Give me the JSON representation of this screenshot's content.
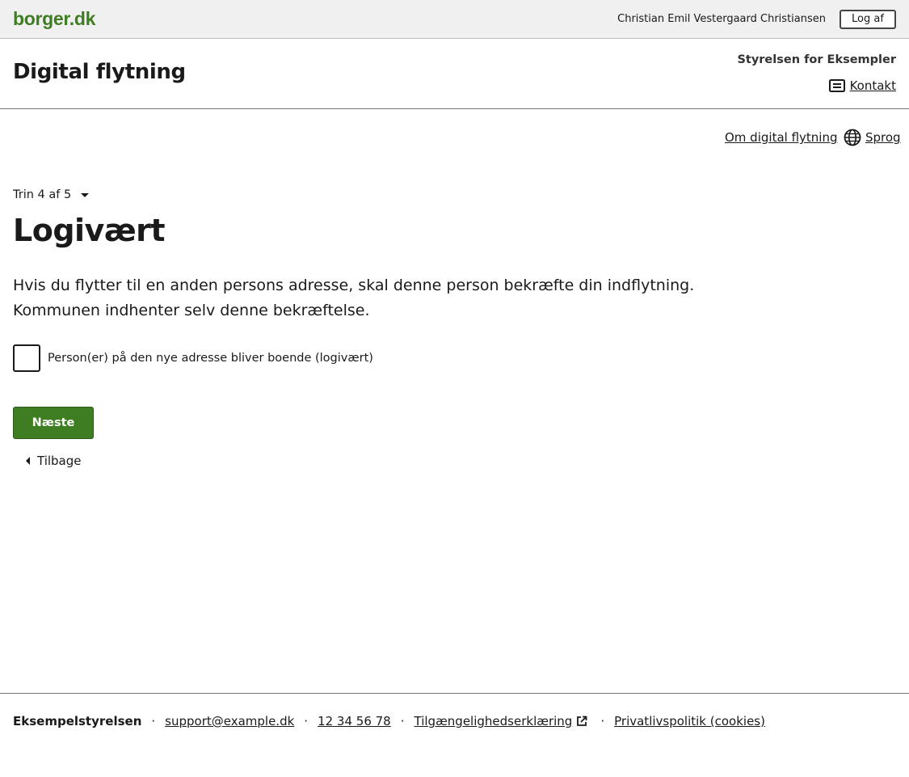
{
  "topbar": {
    "logo": "borger.dk",
    "user_name": "Christian Emil Vestergaard Christiansen",
    "logout_label": "Log af"
  },
  "header": {
    "title": "Digital flytning",
    "authority": "Styrelsen for Eksempler",
    "contact_label": "Kontakt",
    "contact_icon": "message-icon"
  },
  "utility": {
    "about_label": "Om digital flytning",
    "language_label": "Sprog",
    "language_icon": "globe-icon"
  },
  "main": {
    "step_label": "Trin 4 af 5",
    "title": "Logivært",
    "intro_line_1": "Hvis du flytter til en anden persons adresse, skal denne person bekræfte din indflytning.",
    "intro_line_2": "Kommunen indhenter selv denne bekræftelse.",
    "checkbox_label": "Person(er) på den nye adresse bliver boende (logivært)",
    "checkbox_checked": false,
    "next_label": "Næste",
    "back_label": "Tilbage"
  },
  "footer": {
    "org": "Eksempelstyrelsen",
    "email": "support@example.dk",
    "phone": "12 34 56 78",
    "accessibility": "Tilgængelighedserklæring",
    "privacy": "Privatlivspolitik (cookies)",
    "separator": "·"
  },
  "colors": {
    "brand_green": "#3f7d23",
    "topbar_bg": "#f0f0f0",
    "text": "#1a1a1a"
  }
}
